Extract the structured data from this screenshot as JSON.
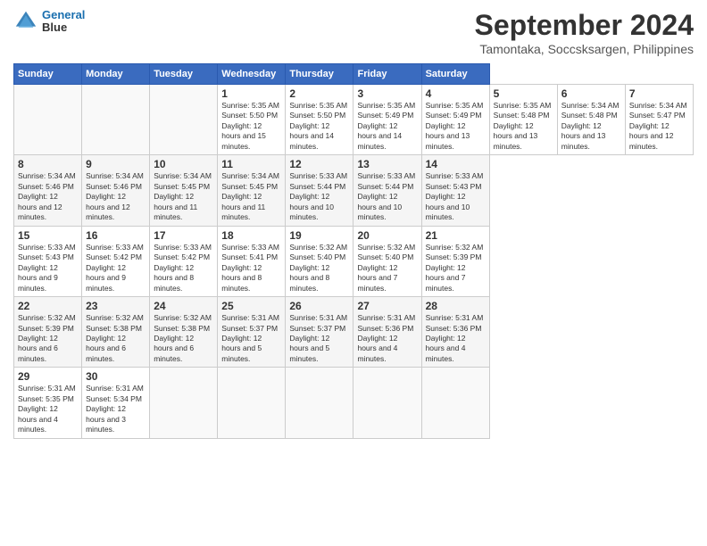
{
  "header": {
    "logo_line1": "General",
    "logo_line2": "Blue",
    "title": "September 2024",
    "subtitle": "Tamontaka, Soccsksargen, Philippines"
  },
  "calendar": {
    "days_of_week": [
      "Sunday",
      "Monday",
      "Tuesday",
      "Wednesday",
      "Thursday",
      "Friday",
      "Saturday"
    ],
    "weeks": [
      [
        null,
        null,
        null,
        null,
        null,
        null,
        null
      ]
    ]
  },
  "cells": {
    "w1": [
      null,
      null,
      null,
      {
        "num": "1",
        "sunrise": "Sunrise: 5:35 AM",
        "sunset": "Sunset: 5:50 PM",
        "daylight": "Daylight: 12 hours and 15 minutes."
      },
      {
        "num": "2",
        "sunrise": "Sunrise: 5:35 AM",
        "sunset": "Sunset: 5:50 PM",
        "daylight": "Daylight: 12 hours and 14 minutes."
      },
      {
        "num": "3",
        "sunrise": "Sunrise: 5:35 AM",
        "sunset": "Sunset: 5:49 PM",
        "daylight": "Daylight: 12 hours and 14 minutes."
      },
      {
        "num": "4",
        "sunrise": "Sunrise: 5:35 AM",
        "sunset": "Sunset: 5:49 PM",
        "daylight": "Daylight: 12 hours and 13 minutes."
      },
      {
        "num": "5",
        "sunrise": "Sunrise: 5:35 AM",
        "sunset": "Sunset: 5:48 PM",
        "daylight": "Daylight: 12 hours and 13 minutes."
      },
      {
        "num": "6",
        "sunrise": "Sunrise: 5:34 AM",
        "sunset": "Sunset: 5:48 PM",
        "daylight": "Daylight: 12 hours and 13 minutes."
      },
      {
        "num": "7",
        "sunrise": "Sunrise: 5:34 AM",
        "sunset": "Sunset: 5:47 PM",
        "daylight": "Daylight: 12 hours and 12 minutes."
      }
    ],
    "w2": [
      {
        "num": "8",
        "sunrise": "Sunrise: 5:34 AM",
        "sunset": "Sunset: 5:46 PM",
        "daylight": "Daylight: 12 hours and 12 minutes."
      },
      {
        "num": "9",
        "sunrise": "Sunrise: 5:34 AM",
        "sunset": "Sunset: 5:46 PM",
        "daylight": "Daylight: 12 hours and 12 minutes."
      },
      {
        "num": "10",
        "sunrise": "Sunrise: 5:34 AM",
        "sunset": "Sunset: 5:45 PM",
        "daylight": "Daylight: 12 hours and 11 minutes."
      },
      {
        "num": "11",
        "sunrise": "Sunrise: 5:34 AM",
        "sunset": "Sunset: 5:45 PM",
        "daylight": "Daylight: 12 hours and 11 minutes."
      },
      {
        "num": "12",
        "sunrise": "Sunrise: 5:33 AM",
        "sunset": "Sunset: 5:44 PM",
        "daylight": "Daylight: 12 hours and 10 minutes."
      },
      {
        "num": "13",
        "sunrise": "Sunrise: 5:33 AM",
        "sunset": "Sunset: 5:44 PM",
        "daylight": "Daylight: 12 hours and 10 minutes."
      },
      {
        "num": "14",
        "sunrise": "Sunrise: 5:33 AM",
        "sunset": "Sunset: 5:43 PM",
        "daylight": "Daylight: 12 hours and 10 minutes."
      }
    ],
    "w3": [
      {
        "num": "15",
        "sunrise": "Sunrise: 5:33 AM",
        "sunset": "Sunset: 5:43 PM",
        "daylight": "Daylight: 12 hours and 9 minutes."
      },
      {
        "num": "16",
        "sunrise": "Sunrise: 5:33 AM",
        "sunset": "Sunset: 5:42 PM",
        "daylight": "Daylight: 12 hours and 9 minutes."
      },
      {
        "num": "17",
        "sunrise": "Sunrise: 5:33 AM",
        "sunset": "Sunset: 5:42 PM",
        "daylight": "Daylight: 12 hours and 8 minutes."
      },
      {
        "num": "18",
        "sunrise": "Sunrise: 5:33 AM",
        "sunset": "Sunset: 5:41 PM",
        "daylight": "Daylight: 12 hours and 8 minutes."
      },
      {
        "num": "19",
        "sunrise": "Sunrise: 5:32 AM",
        "sunset": "Sunset: 5:40 PM",
        "daylight": "Daylight: 12 hours and 8 minutes."
      },
      {
        "num": "20",
        "sunrise": "Sunrise: 5:32 AM",
        "sunset": "Sunset: 5:40 PM",
        "daylight": "Daylight: 12 hours and 7 minutes."
      },
      {
        "num": "21",
        "sunrise": "Sunrise: 5:32 AM",
        "sunset": "Sunset: 5:39 PM",
        "daylight": "Daylight: 12 hours and 7 minutes."
      }
    ],
    "w4": [
      {
        "num": "22",
        "sunrise": "Sunrise: 5:32 AM",
        "sunset": "Sunset: 5:39 PM",
        "daylight": "Daylight: 12 hours and 6 minutes."
      },
      {
        "num": "23",
        "sunrise": "Sunrise: 5:32 AM",
        "sunset": "Sunset: 5:38 PM",
        "daylight": "Daylight: 12 hours and 6 minutes."
      },
      {
        "num": "24",
        "sunrise": "Sunrise: 5:32 AM",
        "sunset": "Sunset: 5:38 PM",
        "daylight": "Daylight: 12 hours and 6 minutes."
      },
      {
        "num": "25",
        "sunrise": "Sunrise: 5:31 AM",
        "sunset": "Sunset: 5:37 PM",
        "daylight": "Daylight: 12 hours and 5 minutes."
      },
      {
        "num": "26",
        "sunrise": "Sunrise: 5:31 AM",
        "sunset": "Sunset: 5:37 PM",
        "daylight": "Daylight: 12 hours and 5 minutes."
      },
      {
        "num": "27",
        "sunrise": "Sunrise: 5:31 AM",
        "sunset": "Sunset: 5:36 PM",
        "daylight": "Daylight: 12 hours and 4 minutes."
      },
      {
        "num": "28",
        "sunrise": "Sunrise: 5:31 AM",
        "sunset": "Sunset: 5:36 PM",
        "daylight": "Daylight: 12 hours and 4 minutes."
      }
    ],
    "w5": [
      {
        "num": "29",
        "sunrise": "Sunrise: 5:31 AM",
        "sunset": "Sunset: 5:35 PM",
        "daylight": "Daylight: 12 hours and 4 minutes."
      },
      {
        "num": "30",
        "sunrise": "Sunrise: 5:31 AM",
        "sunset": "Sunset: 5:34 PM",
        "daylight": "Daylight: 12 hours and 3 minutes."
      },
      null,
      null,
      null,
      null,
      null
    ]
  }
}
